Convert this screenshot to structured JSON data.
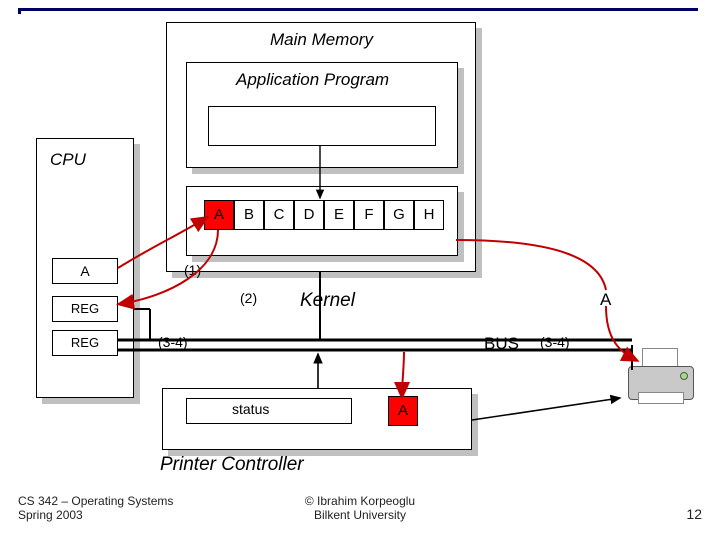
{
  "main_memory": {
    "title": "Main Memory"
  },
  "app": {
    "title": "Application Program"
  },
  "cpu": {
    "title": "CPU",
    "reg_a": "A",
    "reg1": "REG",
    "reg2": "REG"
  },
  "cells": [
    "A",
    "B",
    "C",
    "D",
    "E",
    "F",
    "G",
    "H"
  ],
  "kernel": {
    "title": "Kernel"
  },
  "steps": {
    "s1": "(1)",
    "s2": "(2)",
    "s34_left": "(3-4)",
    "s34_right": "(3-4)"
  },
  "bus": "BUS",
  "controller": {
    "title": "Printer Controller",
    "status_label": "status",
    "status_cell": "A"
  },
  "right_a": "A",
  "footer": {
    "left1": "CS 342 – Operating Systems",
    "left2": "Spring 2003",
    "center1": "© Ibrahim Korpeoglu",
    "center2": "Bilkent University",
    "page": "12"
  }
}
